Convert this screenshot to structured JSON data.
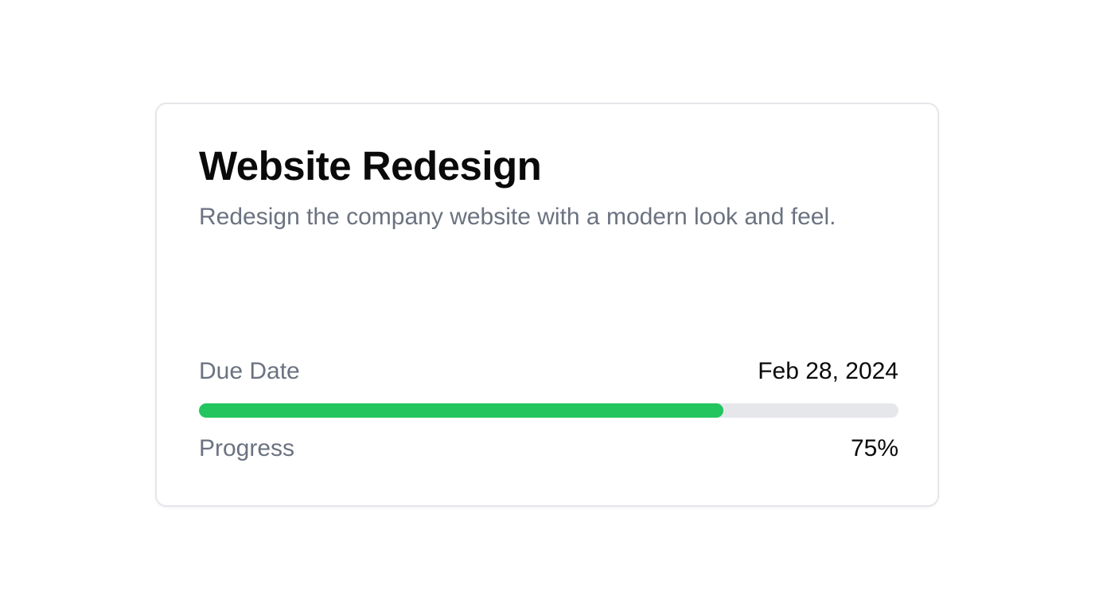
{
  "card": {
    "title": "Website Redesign",
    "description": "Redesign the company website with a modern look and feel.",
    "due_date": {
      "label": "Due Date",
      "value": "Feb 28, 2024"
    },
    "progress": {
      "label": "Progress",
      "display": "75%",
      "percent": 75
    }
  },
  "colors": {
    "progress_fill": "#22c55e",
    "progress_track": "#e5e7eb",
    "muted_text": "#6b7280",
    "primary_text": "#0a0a0a"
  }
}
